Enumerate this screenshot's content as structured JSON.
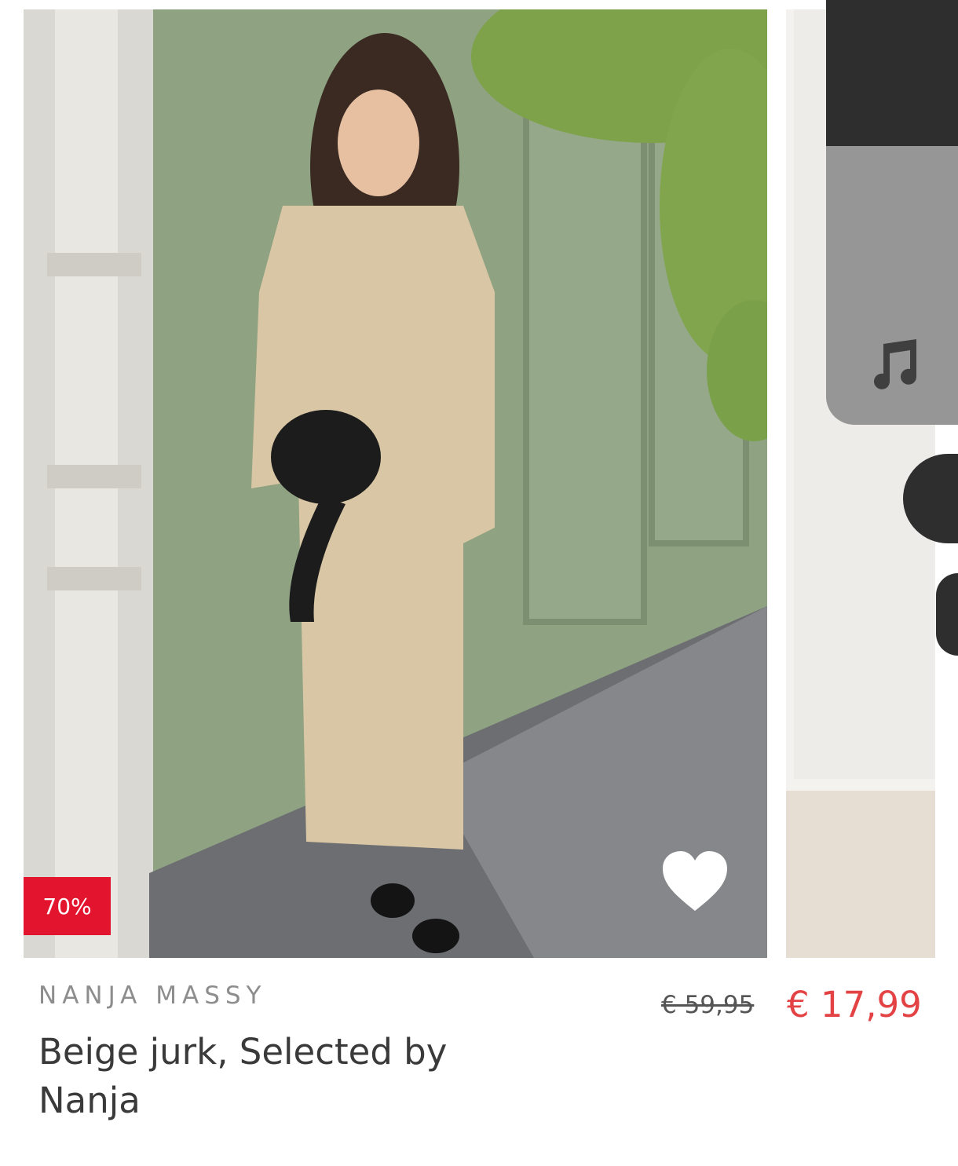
{
  "product": {
    "discount_badge": "70%",
    "brand": "NANJA MASSY",
    "title": "Beige jurk, Selected by Nanja",
    "old_price": "€ 59,95",
    "new_price": "€ 17,99"
  },
  "icons": {
    "favorite": "heart-icon",
    "music": "music-note-icon"
  },
  "colors": {
    "discount": "#e3142d",
    "price": "#e34344"
  }
}
